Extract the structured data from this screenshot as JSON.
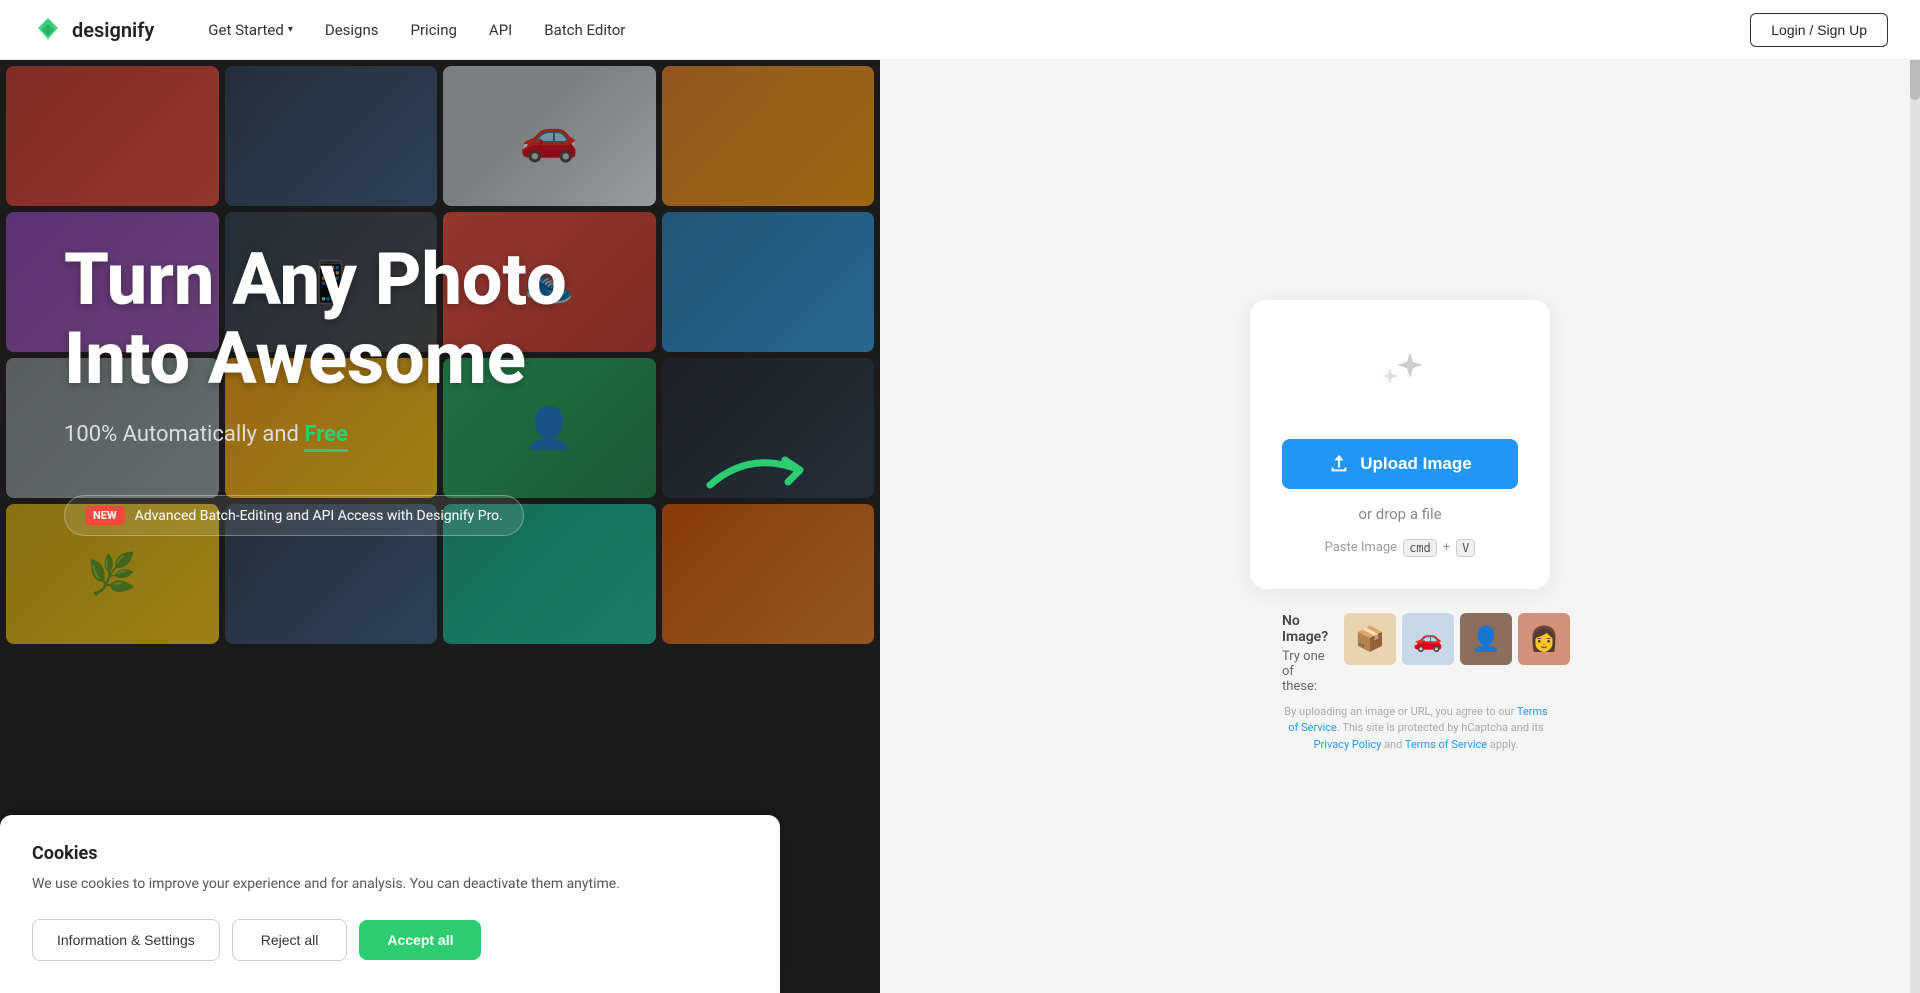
{
  "navbar": {
    "logo_text": "designify",
    "nav_items": [
      {
        "label": "Get Started",
        "has_dropdown": true
      },
      {
        "label": "Designs",
        "has_dropdown": false
      },
      {
        "label": "Pricing",
        "has_dropdown": false
      },
      {
        "label": "API",
        "has_dropdown": false
      },
      {
        "label": "Batch Editor",
        "has_dropdown": false
      }
    ],
    "login_label": "Login / Sign Up"
  },
  "hero": {
    "title_line1": "Turn Any Photo",
    "title_line2": "Into Awesome",
    "subtitle_prefix": "100% Automatically and ",
    "subtitle_free": "Free",
    "badge_new": "NEW",
    "badge_text": "Advanced Batch-Editing and API Access with Designify Pro."
  },
  "upload_panel": {
    "sparkle_icon": "✦",
    "upload_btn_label": "Upload Image",
    "drop_text": "or drop a file",
    "paste_label": "Paste Image",
    "paste_key1": "cmd",
    "paste_plus": "+",
    "paste_key2": "V",
    "no_image_title": "No Image?",
    "no_image_subtitle": "Try one of these:",
    "sample_emojis": [
      "📦",
      "🚗",
      "👤",
      "👩"
    ],
    "tos_text_1": "By uploading an image or URL, you agree to our ",
    "tos_link1": "Terms of Service",
    "tos_text_2": ". This site is protected by hCaptcha and its ",
    "tos_link2": "Privacy Policy",
    "tos_text_3": " and ",
    "tos_link3": "Terms of Service",
    "tos_text_4": " apply."
  },
  "cookie_banner": {
    "title": "Cookies",
    "description": "We use cookies to improve your experience and for analysis. You can deactivate them anytime.",
    "btn_info": "Information & Settings",
    "btn_reject": "Reject all",
    "btn_accept": "Accept all"
  }
}
